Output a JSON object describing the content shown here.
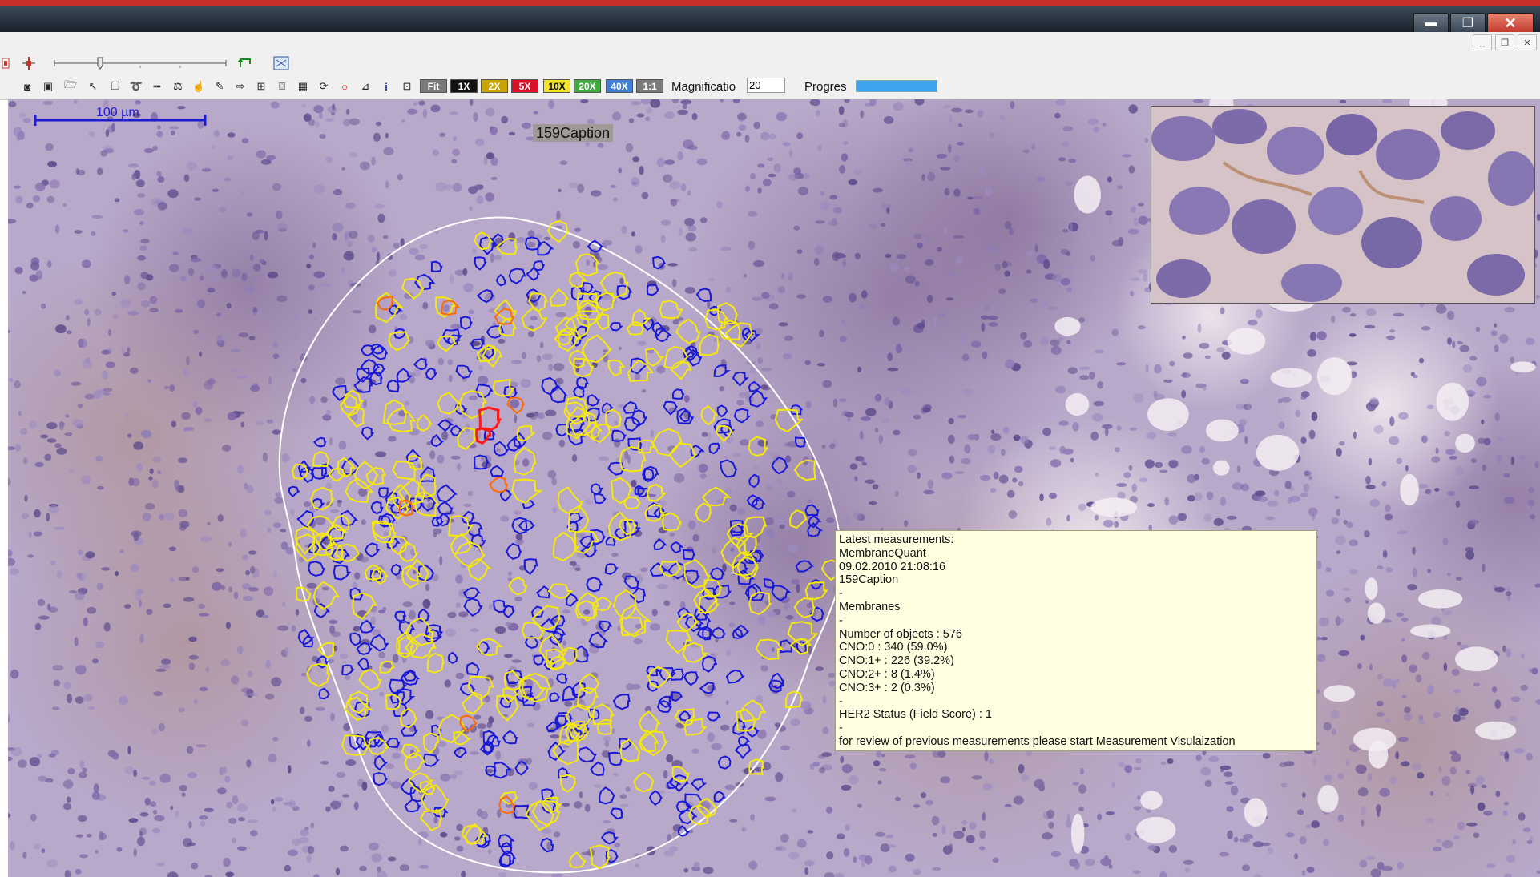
{
  "toolbar": {
    "zoom_buttons": [
      {
        "label": "Fit",
        "bg": "#7a7a7a",
        "fg": "#ffffff"
      },
      {
        "label": "1X",
        "bg": "#111111",
        "fg": "#ffffff"
      },
      {
        "label": "2X",
        "bg": "#c9a300",
        "fg": "#ffffff"
      },
      {
        "label": "5X",
        "bg": "#d8102a",
        "fg": "#ffffff"
      },
      {
        "label": "10X",
        "bg": "#f1e42a",
        "fg": "#111111"
      },
      {
        "label": "20X",
        "bg": "#3eab3e",
        "fg": "#ffffff"
      },
      {
        "label": "40X",
        "bg": "#3f7fd8",
        "fg": "#ffffff"
      },
      {
        "label": "1:1",
        "bg": "#7a7a7a",
        "fg": "#ffffff"
      }
    ],
    "magnification_label": "Magnificatio",
    "magnification_value": "20",
    "progress_label": "Progres",
    "progress_fraction": 1.0,
    "progress_color": "#3da3f0"
  },
  "viewer": {
    "scale_bar_label": "100 µm",
    "scale_bar_color": "#1c1cd0",
    "caption": "159Caption",
    "cell_colors": {
      "cno0": "#1818d8",
      "cno1": "#f5e90a",
      "cno2": "#ff6a00",
      "cno3": "#ff1a1a"
    }
  },
  "measurements": {
    "lines": [
      "Latest measurements:",
      "MembraneQuant",
      "09.02.2010 21:08:16",
      "159Caption",
      "-",
      "Membranes",
      "-",
      "Number of objects : 576",
      "CNO:0  : 340  (59.0%)",
      "CNO:1+ : 226  (39.2%)",
      "CNO:2+ : 8  (1.4%)",
      "CNO:3+ : 2  (0.3%)",
      "-",
      "HER2 Status (Field Score) : 1",
      "-",
      "for review of previous measurements please start Measurement Visulaization"
    ]
  }
}
